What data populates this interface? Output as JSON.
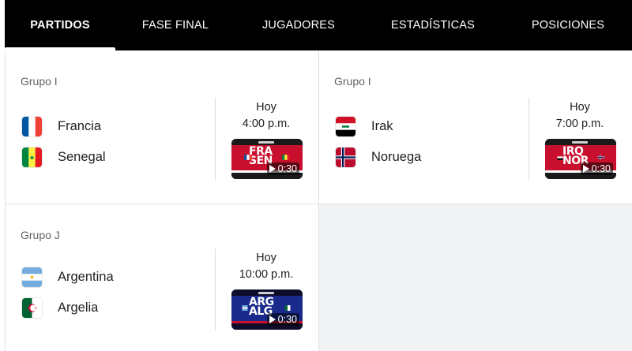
{
  "tabs": [
    {
      "label": "PARTIDOS",
      "active": true
    },
    {
      "label": "FASE FINAL",
      "active": false
    },
    {
      "label": "JUGADORES",
      "active": false
    },
    {
      "label": "ESTADÍSTICAS",
      "active": false
    },
    {
      "label": "POSICIONES",
      "active": false
    }
  ],
  "matches": [
    {
      "group": "Grupo I",
      "team1": {
        "name": "Francia",
        "flag": "france-flag"
      },
      "team2": {
        "name": "Senegal",
        "flag": "senegal-flag"
      },
      "day": "Hoy",
      "time": "4:00 p.m.",
      "video": {
        "title_line1": "FRA",
        "title_line2": "SEN",
        "duration": "0:30",
        "theme_color": "#c8102e"
      }
    },
    {
      "group": "Grupo I",
      "team1": {
        "name": "Irak",
        "flag": "iraq-flag"
      },
      "team2": {
        "name": "Noruega",
        "flag": "norway-flag"
      },
      "day": "Hoy",
      "time": "7:00 p.m.",
      "video": {
        "title_line1": "IRQ",
        "title_line2": "NOR",
        "duration": "0:30",
        "theme_color": "#c8102e"
      }
    },
    {
      "group": "Grupo J",
      "team1": {
        "name": "Argentina",
        "flag": "argentina-flag"
      },
      "team2": {
        "name": "Argelia",
        "flag": "algeria-flag"
      },
      "day": "Hoy",
      "time": "10:00 p.m.",
      "video": {
        "title_line1": "ARG",
        "title_line2": "ALG",
        "duration": "0:30",
        "theme_color": "#1a2a8c"
      }
    }
  ]
}
